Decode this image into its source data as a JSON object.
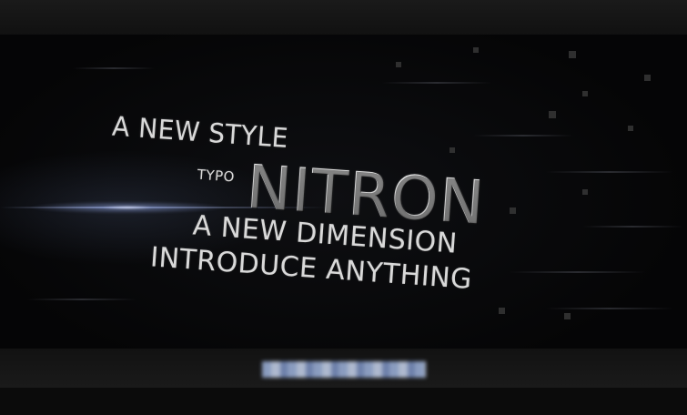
{
  "video": {
    "lines": {
      "line1": "A NEW STYLE",
      "line2": "TYPO",
      "line3": "NITRON",
      "line4": "A NEW DIMENSION",
      "line5": "INTRODUCE ANYTHING"
    },
    "colors": {
      "background": "#0b0b0b",
      "text": "#d9d9d9",
      "flare": "#a9b9eb"
    }
  }
}
